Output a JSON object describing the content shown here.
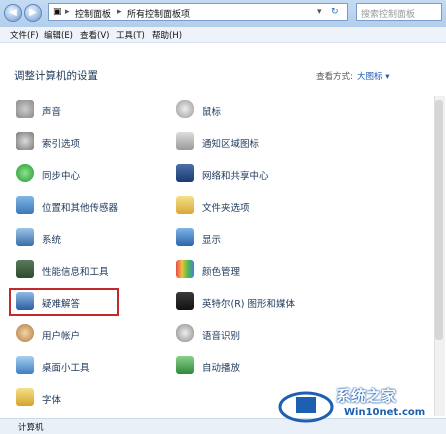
{
  "address": {
    "root": "控制面板",
    "sub": "所有控制面板项"
  },
  "search": {
    "placeholder": "搜索控制面板"
  },
  "menu": [
    "文件(F)",
    "编辑(E)",
    "查看(V)",
    "工具(T)",
    "帮助(H)"
  ],
  "page_title": "调整计算机的设置",
  "view": {
    "label": "查看方式:",
    "value": "大图标 ▾"
  },
  "left_items": [
    "声音",
    "索引选项",
    "同步中心",
    "位置和其他传感器",
    "系统",
    "性能信息和工具",
    "疑难解答",
    "用户帐户",
    "桌面小工具",
    "字体"
  ],
  "right_items": [
    "鼠标",
    "通知区域图标",
    "网络和共享中心",
    "文件夹选项",
    "显示",
    "颜色管理",
    "英特尔(R) 图形和媒体",
    "语音识别",
    "自动播放"
  ],
  "status": "计算机",
  "watermark": {
    "title": "系统之家",
    "url": "Win10net.com"
  },
  "colors": {
    "accent": "#1e395b",
    "highlight": "#c02a2a"
  }
}
